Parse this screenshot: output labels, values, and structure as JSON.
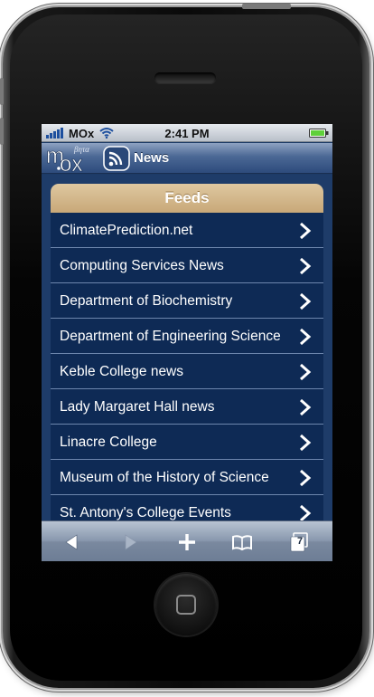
{
  "status_bar": {
    "carrier": "MOx",
    "time": "2:41 PM",
    "icons": [
      "signal-bars-icon",
      "wifi-icon",
      "battery-icon"
    ],
    "battery_color": "#5fd03a"
  },
  "app_header": {
    "logo_text": "mox",
    "logo_beta": "βητα",
    "section_icon": "rss-icon",
    "section_title": "News"
  },
  "feeds": {
    "title": "Feeds",
    "items": [
      "ClimatePrediction.net",
      "Computing Services News",
      "Department of Biochemistry",
      "Department of Engineering Science",
      "Keble College news",
      "Lady Margaret Hall news",
      "Linacre College",
      "Museum of the History of Science",
      "St. Antony's College Events"
    ]
  },
  "toolbar": {
    "buttons": [
      "back-icon",
      "forward-icon",
      "add-bookmark-icon",
      "bookmarks-icon",
      "pages-icon"
    ],
    "pages_count": "7"
  },
  "colors": {
    "header_gold": "#c8a878",
    "list_background": "#0e2a55",
    "page_background": "#1e3c69",
    "divider": "#6d86ad"
  }
}
